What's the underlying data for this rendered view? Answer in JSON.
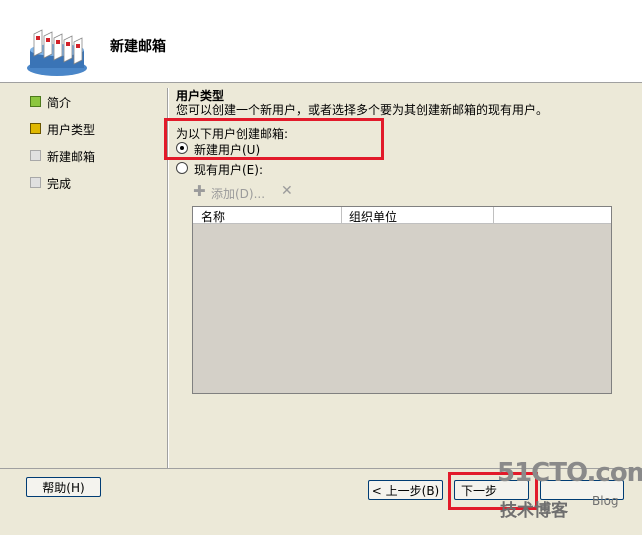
{
  "header": {
    "title": "新建邮箱"
  },
  "sidebar": {
    "items": [
      {
        "label": "简介",
        "color": "#7ab437"
      },
      {
        "label": "用户类型",
        "color": "#c8a400"
      },
      {
        "label": "新建邮箱",
        "color": "#d9d9d9"
      },
      {
        "label": "完成",
        "color": "#d9d9d9"
      }
    ]
  },
  "main": {
    "section_title": "用户类型",
    "section_desc": "您可以创建一个新用户，或者选择多个要为其创建新邮箱的现有用户。",
    "group_label": "为以下用户创建邮箱:",
    "option_new": "新建用户(U)",
    "option_existing": "现有用户(E):",
    "toolbar_add": "添加(D)...",
    "columns": [
      "名称",
      "组织单位"
    ]
  },
  "footer": {
    "help": "帮助(H)",
    "back": "< 上一步(B)",
    "next": "下一步"
  },
  "watermark": {
    "site": "51CTO.com",
    "blog": "技术博客",
    "blog_en": "Blog"
  },
  "colors": {
    "highlight": "#e21a2a"
  }
}
